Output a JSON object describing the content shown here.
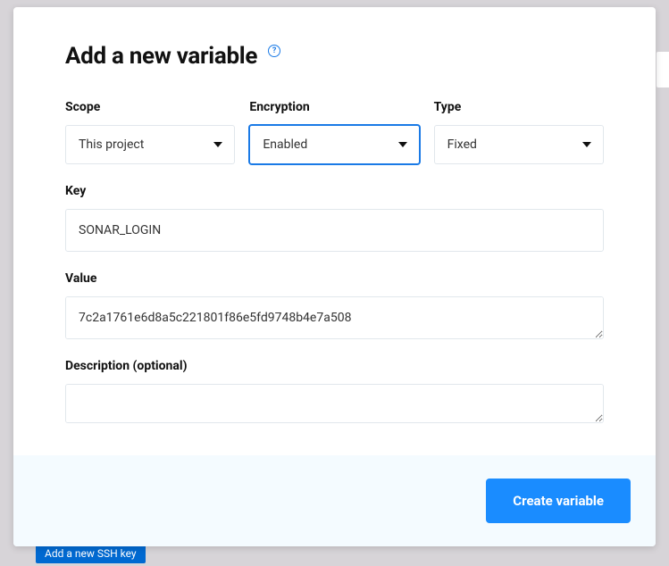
{
  "dialog": {
    "title": "Add a new variable",
    "help_tooltip": "?"
  },
  "fields": {
    "scope": {
      "label": "Scope",
      "value": "This project"
    },
    "encryption": {
      "label": "Encryption",
      "value": "Enabled"
    },
    "type": {
      "label": "Type",
      "value": "Fixed"
    },
    "key": {
      "label": "Key",
      "value": "SONAR_LOGIN"
    },
    "value": {
      "label": "Value",
      "value": "7c2a1761e6d8a5c221801f86e5fd9748b4e7a508"
    },
    "description": {
      "label": "Description (optional)",
      "value": ""
    }
  },
  "footer": {
    "submit_label": "Create variable"
  },
  "background": {
    "ssh_button_label": "Add a new SSH key"
  }
}
